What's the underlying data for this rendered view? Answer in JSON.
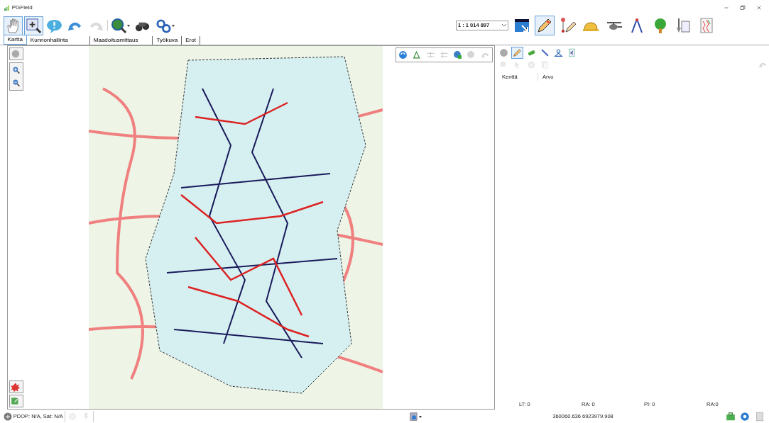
{
  "window": {
    "title": "PGField"
  },
  "toolbar_left": [
    {
      "selected": true,
      "disabled": false,
      "dropdown": false
    },
    {
      "selected": true,
      "disabled": false,
      "dropdown": false
    },
    {
      "selected": false,
      "disabled": false,
      "dropdown": false
    },
    {
      "selected": false,
      "disabled": false,
      "dropdown": false
    },
    {
      "selected": false,
      "disabled": true,
      "dropdown": false
    },
    {
      "selected": false,
      "disabled": false,
      "dropdown": true
    },
    {
      "selected": false,
      "disabled": false,
      "dropdown": false
    },
    {
      "selected": false,
      "disabled": false,
      "dropdown": true
    }
  ],
  "scale": {
    "value": "1 : 1 014 897"
  },
  "toolbar_right": [
    {
      "selected": false
    },
    {
      "selected": true
    },
    {
      "selected": false
    },
    {
      "selected": false
    },
    {
      "selected": false
    },
    {
      "selected": false
    },
    {
      "selected": false
    },
    {
      "selected": false
    },
    {
      "selected": false
    }
  ],
  "tabs": [
    {
      "label": "Kartta",
      "selected": true
    },
    {
      "label": "Kunnonhallinta",
      "selected": false
    },
    {
      "label": "Maadoitusmittaus",
      "selected": false
    },
    {
      "label": "Työkuva",
      "selected": false
    },
    {
      "label": "Erot",
      "selected": false
    }
  ],
  "map_toolbar": [
    {
      "disabled": false
    },
    {
      "disabled": false
    },
    {
      "disabled": true
    },
    {
      "disabled": true
    },
    {
      "disabled": false
    },
    {
      "disabled": true
    },
    {
      "disabled": true
    }
  ],
  "panel_tabs": [
    {
      "selected": false
    },
    {
      "selected": true
    },
    {
      "selected": false
    },
    {
      "selected": false
    },
    {
      "selected": false
    },
    {
      "selected": false
    }
  ],
  "properties": {
    "columns": [
      "Kenttä",
      "Arvo"
    ]
  },
  "counters": [
    {
      "label": "LT: 0"
    },
    {
      "label": "RA: 0"
    },
    {
      "label": "PI: 0"
    },
    {
      "label": "RA:0"
    }
  ],
  "status_bar": {
    "gps": "PDOP: N/A, Sat: N/A",
    "coordinates": "360060.636 6923979.908"
  }
}
